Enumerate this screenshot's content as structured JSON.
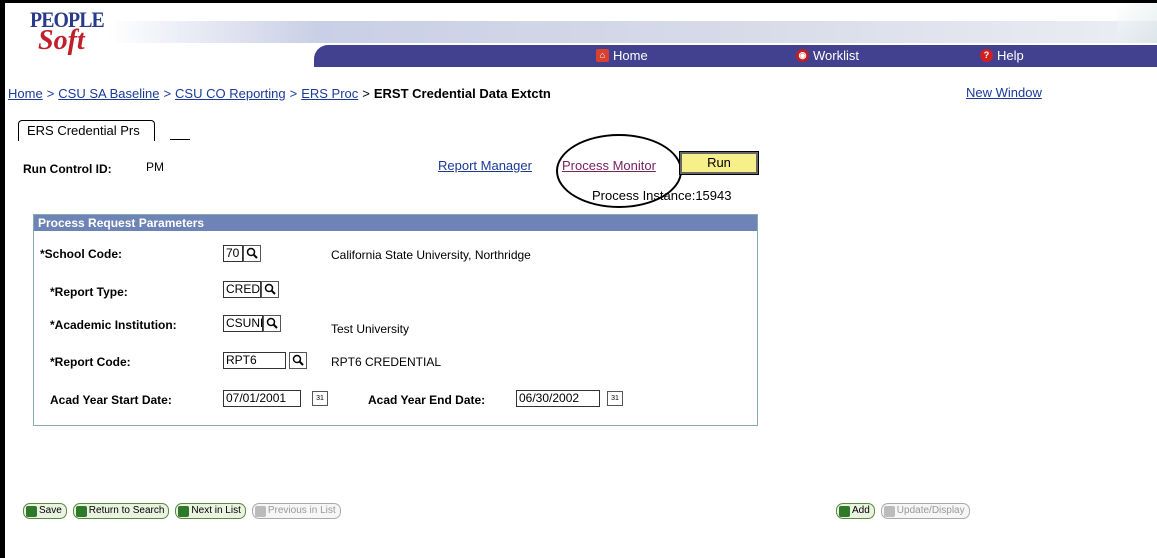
{
  "header": {
    "logo_top": "PEOPLE",
    "logo_bottom": "Soft",
    "nav": [
      {
        "label": "Home",
        "icon": "home-icon"
      },
      {
        "label": "Worklist",
        "icon": "worklist-icon"
      },
      {
        "label": "Help",
        "icon": "help-icon"
      }
    ]
  },
  "breadcrumb": {
    "items": [
      "Home",
      "CSU SA Baseline",
      "CSU CO Reporting",
      "ERS Proc"
    ],
    "current": "ERST Credential Data Extctn",
    "separator": ">"
  },
  "new_window": "New Window",
  "tab": "ERS Credential Prs",
  "run_control": {
    "label": "Run Control ID:",
    "value": "PM"
  },
  "links": {
    "report_manager": "Report Manager",
    "process_monitor": "Process Monitor"
  },
  "run_button": "Run",
  "process_instance": "Process Instance:15943",
  "panel": {
    "title": "Process Request Parameters",
    "school_code": {
      "label": "*School Code:",
      "value": "70",
      "desc": "California State University, Northridge"
    },
    "report_type": {
      "label": "*Report Type:",
      "value": "CRED"
    },
    "acad_inst": {
      "label": "*Academic Institution:",
      "value": "CSUNF",
      "desc": "Test University"
    },
    "report_code": {
      "label": "*Report Code:",
      "value": "RPT6",
      "desc": "RPT6 CREDENTIAL"
    },
    "start_date": {
      "label": "Acad Year Start Date:",
      "value": "07/01/2001"
    },
    "end_date": {
      "label": "Acad Year End Date:",
      "value": "06/30/2002"
    }
  },
  "toolbar": {
    "save": "Save",
    "return": "Return to Search",
    "next": "Next in List",
    "previous": "Previous in List",
    "add": "Add",
    "update": "Update/Display"
  },
  "colors": {
    "nav_bg": "#41418f",
    "panel_head": "#6f84b6",
    "link": "#1a3a9a",
    "run_btn": "#f6ef8a"
  }
}
